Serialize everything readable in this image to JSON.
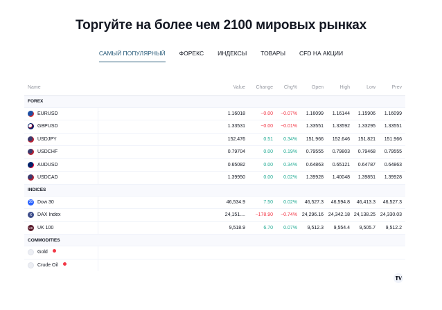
{
  "headline": "Торгуйте на более чем 2100 мировых рынках",
  "tabs": [
    {
      "label": "САМЫЙ ПОПУЛЯРНЫЙ",
      "active": true
    },
    {
      "label": "ФОРЕКС",
      "active": false
    },
    {
      "label": "ИНДЕКСЫ",
      "active": false
    },
    {
      "label": "ТОВАРЫ",
      "active": false
    },
    {
      "label": "CFD НА АКЦИИ",
      "active": false
    }
  ],
  "table": {
    "headers": {
      "name": "Name",
      "value": "Value",
      "change": "Change",
      "chg_pct": "Chg%",
      "open": "Open",
      "high": "High",
      "low": "Low",
      "prev": "Prev"
    },
    "groups": [
      {
        "label": "FOREX",
        "rows": [
          {
            "name": "EURUSD",
            "icon": "eur-flag-icon",
            "value": "1.16018",
            "change": "−0.00",
            "chg_pct": "−0.07%",
            "dir": "neg",
            "open": "1.16099",
            "high": "1.16144",
            "low": "1.15906",
            "prev": "1.16099"
          },
          {
            "name": "GBPUSD",
            "icon": "gbp-flag-icon",
            "value": "1.33531",
            "change": "−0.00",
            "chg_pct": "−0.01%",
            "dir": "neg",
            "open": "1.33551",
            "high": "1.33592",
            "low": "1.33295",
            "prev": "1.33551"
          },
          {
            "name": "USDJPY",
            "icon": "usd-flag-icon",
            "value": "152.476",
            "change": "0.51",
            "chg_pct": "0.34%",
            "dir": "pos",
            "open": "151.966",
            "high": "152.646",
            "low": "151.821",
            "prev": "151.966"
          },
          {
            "name": "USDCHF",
            "icon": "usd-flag-icon",
            "value": "0.79704",
            "change": "0.00",
            "chg_pct": "0.19%",
            "dir": "pos",
            "open": "0.79555",
            "high": "0.79803",
            "low": "0.79468",
            "prev": "0.79555"
          },
          {
            "name": "AUDUSD",
            "icon": "aud-flag-icon",
            "value": "0.65082",
            "change": "0.00",
            "chg_pct": "0.34%",
            "dir": "pos",
            "open": "0.64863",
            "high": "0.65121",
            "low": "0.64787",
            "prev": "0.64863"
          },
          {
            "name": "USDCAD",
            "icon": "usd-flag-icon",
            "value": "1.39950",
            "change": "0.00",
            "chg_pct": "0.02%",
            "dir": "pos",
            "open": "1.39928",
            "high": "1.40048",
            "low": "1.39851",
            "prev": "1.39928"
          }
        ]
      },
      {
        "label": "INDICES",
        "rows": [
          {
            "name": "Dow 30",
            "icon": "dow-index-icon",
            "value": "46,534.9",
            "change": "7.50",
            "chg_pct": "0.02%",
            "dir": "pos",
            "open": "46,527.3",
            "high": "46,594.8",
            "low": "46,413.3",
            "prev": "46,527.3"
          },
          {
            "name": "DAX Index",
            "icon": "dax-index-icon",
            "value": "24,151....",
            "change": "−178.90",
            "chg_pct": "−0.74%",
            "dir": "neg",
            "open": "24,296.16",
            "high": "24,342.18",
            "low": "24,138.25",
            "prev": "24,330.03"
          },
          {
            "name": "UK 100",
            "icon": "uk100-index-icon",
            "value": "9,518.9",
            "change": "6.70",
            "chg_pct": "0.07%",
            "dir": "pos",
            "open": "9,512.3",
            "high": "9,554.4",
            "low": "9,505.7",
            "prev": "9,512.2"
          }
        ]
      },
      {
        "label": "COMMODITIES",
        "rows": [
          {
            "name": "Gold",
            "icon": "gold-icon",
            "value": "",
            "change": "",
            "chg_pct": "",
            "dir": "",
            "open": "",
            "high": "",
            "low": "",
            "prev": ""
          },
          {
            "name": "Crude Oil",
            "icon": "crude-oil-icon",
            "value": "",
            "change": "",
            "chg_pct": "",
            "dir": "",
            "open": "",
            "high": "",
            "low": "",
            "prev": ""
          }
        ]
      }
    ]
  },
  "logo": "tradingview-logo-icon",
  "colors": {
    "negative": "#f23645",
    "positive": "#22ab94",
    "active_tab": "#2a5c7a"
  }
}
